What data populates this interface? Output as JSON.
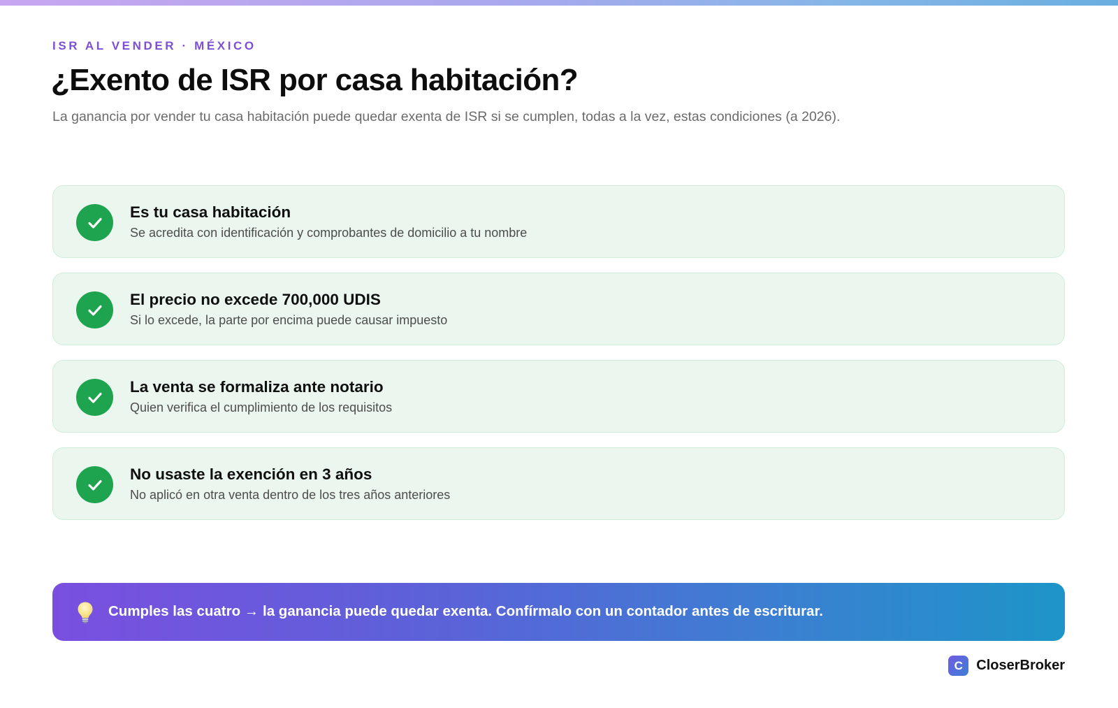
{
  "header": {
    "eyebrow": "ISR AL VENDER · MÉXICO",
    "title": "¿Exento de ISR por casa habitación?",
    "subtitle": "La ganancia por vender tu casa habitación puede quedar exenta de ISR si se cumplen, todas a la vez, estas condiciones (a 2026)."
  },
  "conditions": [
    {
      "icon": "check-circle-icon",
      "title": "Es tu casa habitación",
      "description": "Se acredita con identificación y comprobantes de domicilio a tu nombre"
    },
    {
      "icon": "check-circle-icon",
      "title": "El precio no excede 700,000 UDIS",
      "description": "Si lo excede, la parte por encima puede causar impuesto"
    },
    {
      "icon": "check-circle-icon",
      "title": "La venta se formaliza ante notario",
      "description": "Quien verifica el cumplimiento de los requisitos"
    },
    {
      "icon": "check-circle-icon",
      "title": "No usaste la exención en 3 años",
      "description": "No aplicó en otra venta dentro de los tres años anteriores"
    }
  ],
  "banner": {
    "icon": "lightbulb-icon",
    "text": "Cumples las cuatro → la ganancia puede quedar exenta. Confírmalo con un contador antes de escriturar."
  },
  "brand": {
    "logo_letter": "C",
    "name": "CloserBroker"
  },
  "colors": {
    "accent": "#7c4fd6",
    "success": "#1ea34e",
    "card_background": "#eaf6ee",
    "card_border": "#cfeed9"
  }
}
